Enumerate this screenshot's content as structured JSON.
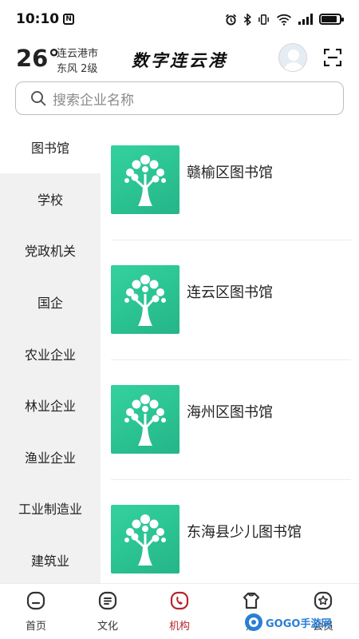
{
  "status_bar": {
    "time": "10:10",
    "nfc_label": "N",
    "battery_level": 0.85
  },
  "header": {
    "temperature": "26°",
    "city": "连云港市",
    "wind": "东风  2级",
    "app_title": "数字连云港"
  },
  "search": {
    "placeholder": "搜索企业名称"
  },
  "sidebar": {
    "items": [
      {
        "label": "图书馆",
        "active": true
      },
      {
        "label": "学校"
      },
      {
        "label": "党政机关"
      },
      {
        "label": "国企"
      },
      {
        "label": "农业企业"
      },
      {
        "label": "林业企业"
      },
      {
        "label": "渔业企业"
      },
      {
        "label": "工业制造业"
      },
      {
        "label": "建筑业"
      }
    ]
  },
  "org_list": {
    "items": [
      {
        "name": "赣榆区图书馆"
      },
      {
        "name": "连云区图书馆"
      },
      {
        "name": "海州区图书馆"
      },
      {
        "name": "东海县少儿图书馆"
      }
    ]
  },
  "bottom_nav": {
    "items": [
      {
        "label": "首页",
        "icon": "home-icon"
      },
      {
        "label": "文化",
        "icon": "culture-icon"
      },
      {
        "label": "机构",
        "icon": "institution-icon",
        "active": true
      },
      {
        "label": "居",
        "icon": "residence-icon"
      },
      {
        "label": "会员",
        "icon": "member-icon"
      }
    ]
  },
  "watermark": {
    "text": "GOGO手游网"
  },
  "colors": {
    "accent": "#b5262b",
    "thumb_green": "#2cc493",
    "sidebar_bg": "#f1f1f1"
  }
}
